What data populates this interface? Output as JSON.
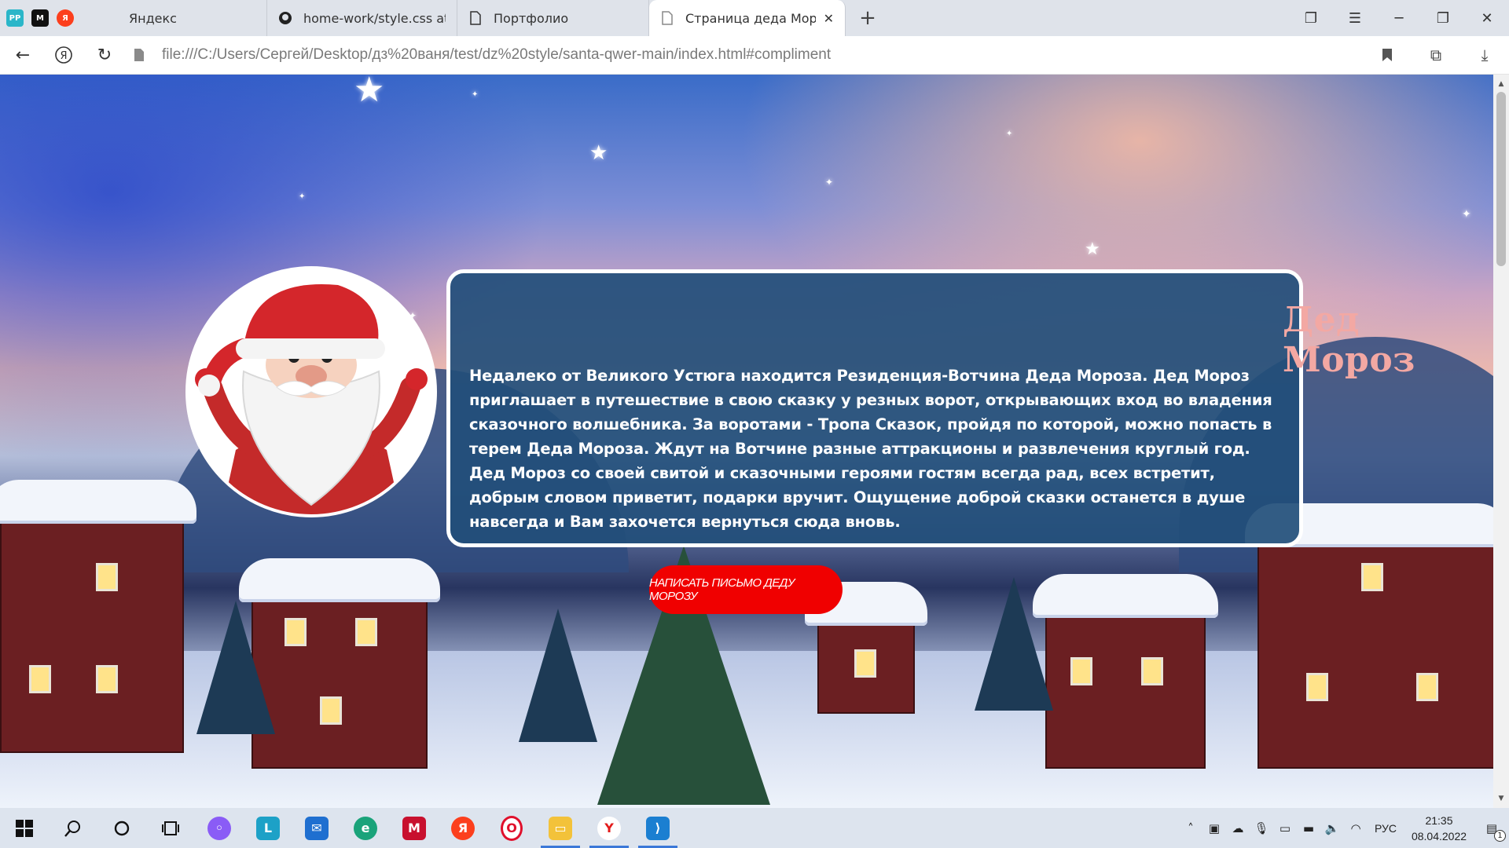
{
  "browser": {
    "tabs": [
      {
        "label": "Яндекс",
        "icon": "yandex-logo-icon"
      },
      {
        "label": "home-work/style.css at ma",
        "icon": "github-icon"
      },
      {
        "label": "Портфолио",
        "icon": "document-icon"
      },
      {
        "label": "Страница деда Мороз",
        "icon": "page-icon",
        "active": true
      }
    ],
    "pinned_icons": [
      "pp-icon",
      "m-icon",
      "yandex-icon"
    ],
    "url": "file:///C:/Users/Сергей/Desktop/дз%20ваня/test/dz%20style/santa-qwer-main/index.html#compliment"
  },
  "page": {
    "heading": "Дед Мороз",
    "description": "Недалеко от Великого Устюга находится Резиденция-Вотчина Деда Мороза. Дед Мороз приглашает в путешествие в свою сказку у резных ворот, открывающих вход во владения сказочного волшебника. За воротами - Тропа Сказок, пройдя по которой, можно попасть в терем Деда Мороза. Ждут на Вотчине разные аттракционы и развлечения круглый год. Дед Мороз со своей свитой и сказочными героями гостям всегда рад, всех встретит, добрым словом приветит, подарки вручит. Ощущение доброй сказки останется в душе навсегда и Вам захочется вернуться сюда вновь.",
    "cta_label": "НАПИСАТЬ ПИСЬМО ДЕДУ МОРОЗУ",
    "colors": {
      "card_bg": "#224e7a",
      "heading": "#f3a8a3",
      "cta_bg": "#f00000"
    }
  },
  "taskbar": {
    "apps": [
      "windows-start-icon",
      "search-icon",
      "cortana-icon",
      "task-view-icon",
      "alice-icon",
      "l-app-icon",
      "mail-icon",
      "edge-icon",
      "mcafee-icon",
      "yandex-icon",
      "opera-icon",
      "file-explorer-icon",
      "yandex-browser-icon",
      "vscode-icon"
    ],
    "language": "РУС",
    "time": "21:35",
    "date": "08.04.2022",
    "notification_count": "1"
  }
}
